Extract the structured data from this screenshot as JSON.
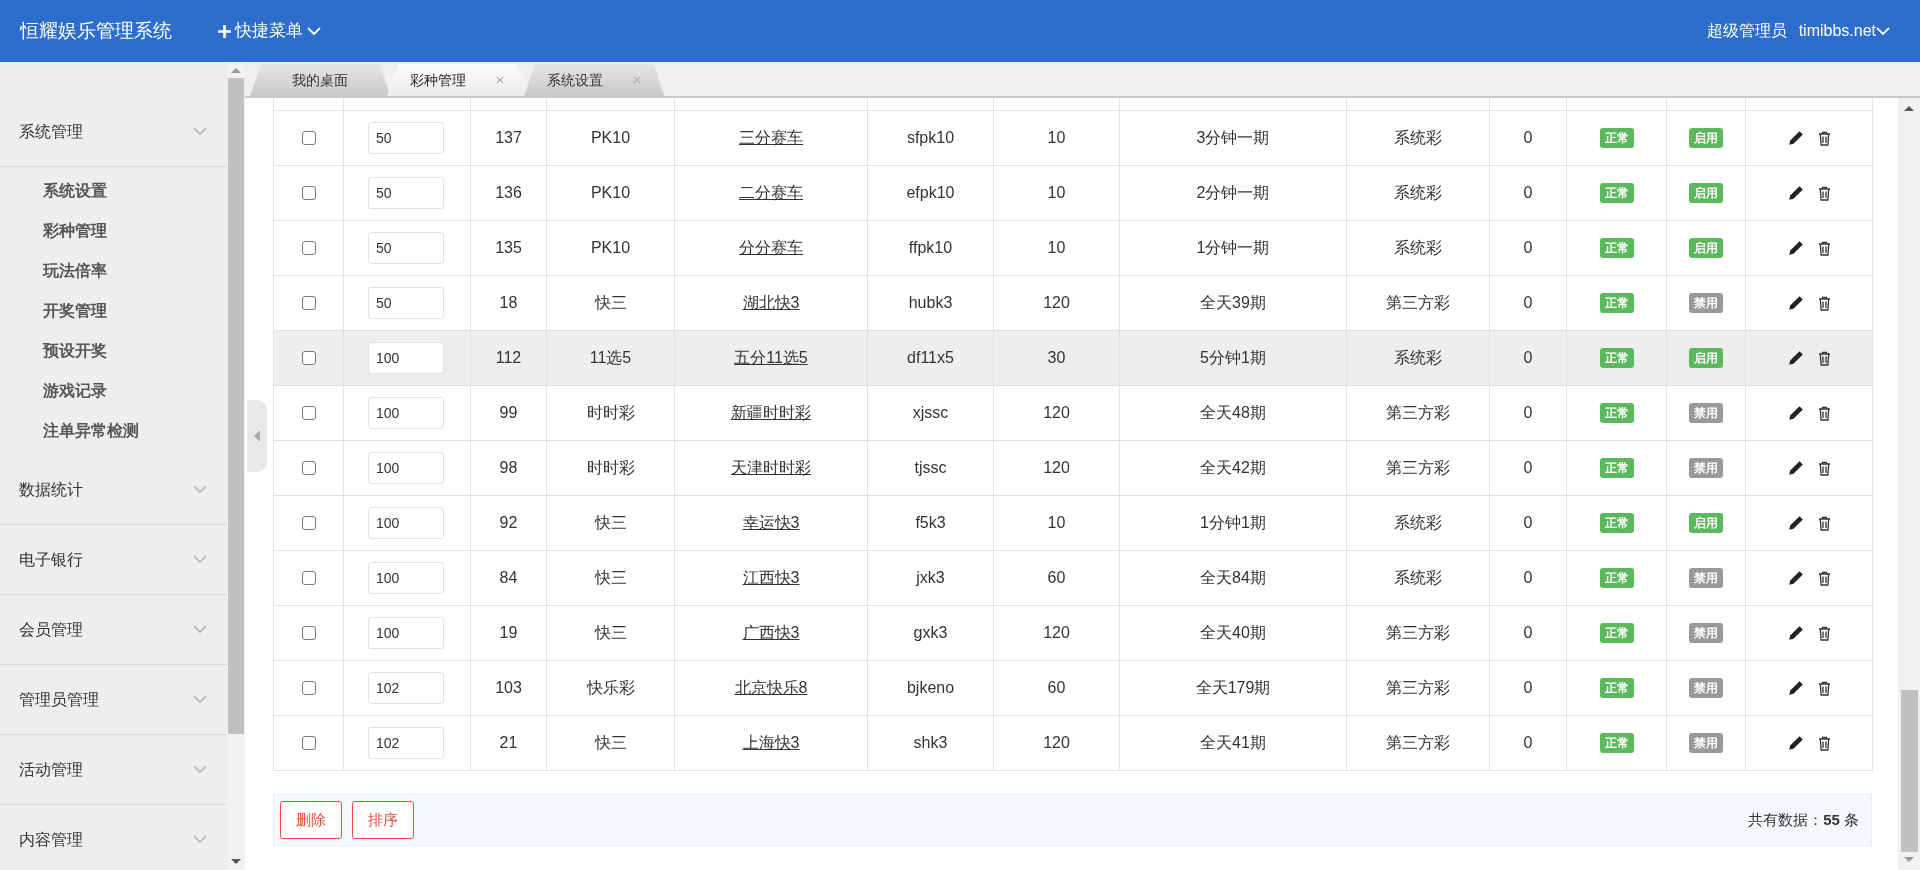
{
  "header": {
    "title": "恒耀娱乐管理系统",
    "quick_menu": "快捷菜单",
    "user_role": "超级管理员",
    "user_name": "timibbs.net"
  },
  "sidebar": {
    "groups": [
      {
        "label": "系统管理",
        "children": [
          {
            "label": "系统设置"
          },
          {
            "label": "彩种管理"
          },
          {
            "label": "玩法倍率"
          },
          {
            "label": "开奖管理"
          },
          {
            "label": "预设开奖"
          },
          {
            "label": "游戏记录"
          },
          {
            "label": "注单异常检测"
          }
        ]
      },
      {
        "label": "数据统计"
      },
      {
        "label": "电子银行"
      },
      {
        "label": "会员管理"
      },
      {
        "label": "管理员管理"
      },
      {
        "label": "活动管理"
      },
      {
        "label": "内容管理"
      }
    ]
  },
  "tabs": [
    {
      "label": "我的桌面",
      "selected": false
    },
    {
      "label": "彩种管理",
      "selected": true,
      "close": "×"
    },
    {
      "label": "系统设置",
      "selected": false,
      "close": "×"
    }
  ],
  "table": {
    "rows": [
      {
        "checked": false,
        "sort": "50",
        "id": "137",
        "category": "PK10",
        "name": "三分赛车",
        "code": "sfpk10",
        "column_7": "10",
        "schedule": "3分钟一期",
        "type": "系统彩",
        "column_10": "0",
        "status": "正常",
        "switch_label": "启用",
        "enabled": true,
        "hovered": false
      },
      {
        "checked": false,
        "sort": "50",
        "id": "136",
        "category": "PK10",
        "name": "二分赛车",
        "code": "efpk10",
        "column_7": "10",
        "schedule": "2分钟一期",
        "type": "系统彩",
        "column_10": "0",
        "status": "正常",
        "switch_label": "启用",
        "enabled": true,
        "hovered": false
      },
      {
        "checked": false,
        "sort": "50",
        "id": "135",
        "category": "PK10",
        "name": "分分赛车",
        "code": "ffpk10",
        "column_7": "10",
        "schedule": "1分钟一期",
        "type": "系统彩",
        "column_10": "0",
        "status": "正常",
        "switch_label": "启用",
        "enabled": true,
        "hovered": false
      },
      {
        "checked": false,
        "sort": "50",
        "id": "18",
        "category": "快三",
        "name": "湖北快3",
        "code": "hubk3",
        "column_7": "120",
        "schedule": "全天39期",
        "type": "第三方彩",
        "column_10": "0",
        "status": "正常",
        "switch_label": "禁用",
        "enabled": false,
        "hovered": false
      },
      {
        "checked": false,
        "sort": "100",
        "id": "112",
        "category": "11选5",
        "name": "五分11选5",
        "code": "df11x5",
        "column_7": "30",
        "schedule": "5分钟1期",
        "type": "系统彩",
        "column_10": "0",
        "status": "正常",
        "switch_label": "启用",
        "enabled": true,
        "hovered": true
      },
      {
        "checked": false,
        "sort": "100",
        "id": "99",
        "category": "时时彩",
        "name": "新疆时时彩",
        "code": "xjssc",
        "column_7": "120",
        "schedule": "全天48期",
        "type": "第三方彩",
        "column_10": "0",
        "status": "正常",
        "switch_label": "禁用",
        "enabled": false,
        "hovered": false
      },
      {
        "checked": false,
        "sort": "100",
        "id": "98",
        "category": "时时彩",
        "name": "天津时时彩",
        "code": "tjssc",
        "column_7": "120",
        "schedule": "全天42期",
        "type": "第三方彩",
        "column_10": "0",
        "status": "正常",
        "switch_label": "禁用",
        "enabled": false,
        "hovered": false
      },
      {
        "checked": false,
        "sort": "100",
        "id": "92",
        "category": "快三",
        "name": "幸运快3",
        "code": "f5k3",
        "column_7": "10",
        "schedule": "1分钟1期",
        "type": "系统彩",
        "column_10": "0",
        "status": "正常",
        "switch_label": "启用",
        "enabled": true,
        "hovered": false
      },
      {
        "checked": false,
        "sort": "100",
        "id": "84",
        "category": "快三",
        "name": "江西快3",
        "code": "jxk3",
        "column_7": "60",
        "schedule": "全天84期",
        "type": "系统彩",
        "column_10": "0",
        "status": "正常",
        "switch_label": "禁用",
        "enabled": false,
        "hovered": false
      },
      {
        "checked": false,
        "sort": "100",
        "id": "19",
        "category": "快三",
        "name": "广西快3",
        "code": "gxk3",
        "column_7": "120",
        "schedule": "全天40期",
        "type": "第三方彩",
        "column_10": "0",
        "status": "正常",
        "switch_label": "禁用",
        "enabled": false,
        "hovered": false
      },
      {
        "checked": false,
        "sort": "102",
        "id": "103",
        "category": "快乐彩",
        "name": "北京快乐8",
        "code": "bjkeno",
        "column_7": "60",
        "schedule": "全天179期",
        "type": "第三方彩",
        "column_10": "0",
        "status": "正常",
        "switch_label": "禁用",
        "enabled": false,
        "hovered": false
      },
      {
        "checked": false,
        "sort": "102",
        "id": "21",
        "category": "快三",
        "name": "上海快3",
        "code": "shk3",
        "column_7": "120",
        "schedule": "全天41期",
        "type": "第三方彩",
        "column_10": "0",
        "status": "正常",
        "switch_label": "禁用",
        "enabled": false,
        "hovered": false
      }
    ]
  },
  "footer": {
    "buttons": [
      "删除",
      "排序"
    ],
    "total": "共有数据：**55** 条"
  }
}
